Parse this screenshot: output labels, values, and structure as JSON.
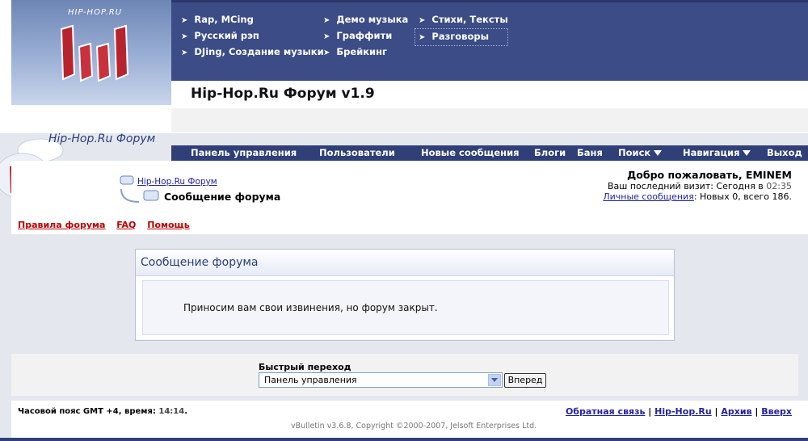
{
  "logo_text": "HIP-HOP.RU",
  "header_nav": {
    "col1": [
      "Rap, MCing",
      "Русский рэп",
      "DJing, Создание музыки"
    ],
    "col2": [
      "Демо музыка",
      "Граффити",
      "Брейкинг"
    ],
    "col3": [
      "Стихи, Тексты",
      "Разговоры"
    ]
  },
  "forum_title": "Hip-Hop.Ru Форум v1.9",
  "side_label": "Hip-Hop.Ru Форум",
  "navbar": {
    "control_panel": "Панель управления",
    "users": "Пользователи",
    "new_posts": "Новые сообщения",
    "blogs": "Блоги",
    "banya": "Баня",
    "search": "Поиск",
    "navigation": "Навигация",
    "logout": "Выход"
  },
  "breadcrumb": {
    "root": "Hip-Hop.Ru Форум",
    "current": "Сообщение форума"
  },
  "welcome": {
    "greeting": "Добро пожаловать, EMINEM",
    "last_visit_label": "Ваш последний визит: Сегодня в",
    "last_visit_time": "02:35",
    "pm_link": "Личные сообщения",
    "pm_counts": ": Новых 0, всего 186."
  },
  "top_links": [
    "Правила форума",
    "FAQ",
    "Помощь"
  ],
  "message": {
    "title": "Сообщение форума",
    "text": "Приносим вам свои извинения, но форум закрыт."
  },
  "quick_jump": {
    "label": "Быстрый переход",
    "selected": "Панель управления",
    "button": "Вперед"
  },
  "footer": {
    "timezone_label": "Часовой пояс GMT +4, время:",
    "time": "14:14",
    "links": [
      "Обратная связь",
      "Hip-Hop.Ru",
      "Архив",
      "Вверх"
    ],
    "copyright": "vBulletin v3.6.8, Copyright ©2000-2007, Jelsoft Enterprises Ltd."
  }
}
